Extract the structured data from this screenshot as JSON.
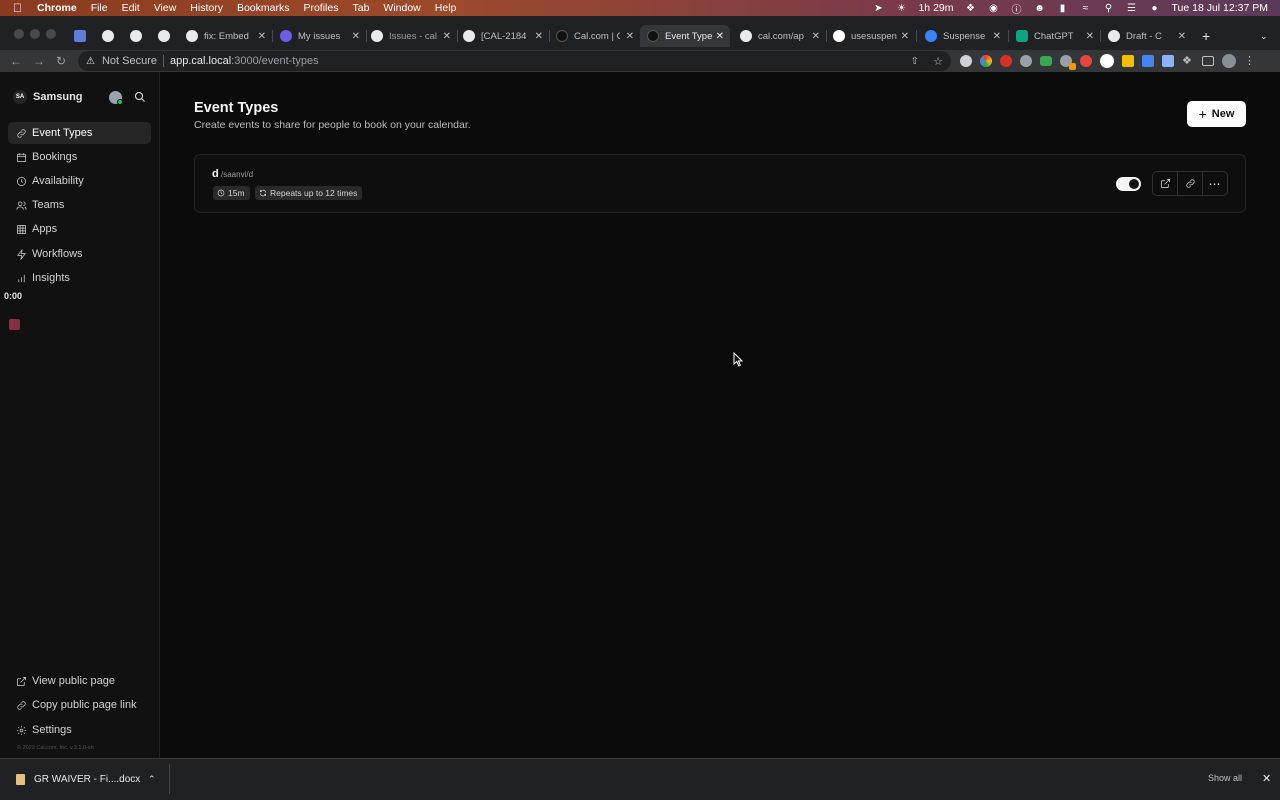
{
  "menubar": {
    "app_name": "Chrome",
    "items": [
      "File",
      "Edit",
      "View",
      "History",
      "Bookmarks",
      "Profiles",
      "Tab",
      "Window",
      "Help"
    ],
    "battery_time": "1h 29m",
    "datetime": "Tue 18 Jul  12:37 PM"
  },
  "tabs": [
    {
      "label": "",
      "fav_color": "#5b7fd6"
    },
    {
      "label": "",
      "fav_color": "#e8eaed"
    },
    {
      "label": "",
      "fav_color": "#e8eaed"
    },
    {
      "label": "",
      "fav_color": "#e8eaed"
    },
    {
      "label": "fix: Embed",
      "fav_color": "#e8eaed"
    },
    {
      "label": "My issues",
      "fav_color": "#6e5de7"
    },
    {
      "label": "Issues - cal",
      "fav_color": "#e8eaed"
    },
    {
      "label": "[CAL-2184",
      "fav_color": "#e8eaed"
    },
    {
      "label": "Cal.com | C",
      "fav_color": "#111111"
    },
    {
      "label": "Event Type",
      "fav_color": "#111111"
    },
    {
      "label": "cal.com/ap",
      "fav_color": "#e8eaed"
    },
    {
      "label": "usesuspen",
      "fav_color": "#ffffff"
    },
    {
      "label": "Suspense",
      "fav_color": "#3b82f6"
    },
    {
      "label": "ChatGPT",
      "fav_color": "#10a37f"
    },
    {
      "label": "Draft - C",
      "fav_color": "#e8eaed"
    }
  ],
  "address": {
    "security": "Not Secure",
    "host": "app.cal.local",
    "path": ":3000/event-types"
  },
  "sidebar": {
    "org_initials": "SA",
    "org_name": "Samsung",
    "items": [
      {
        "label": "Event Types",
        "icon": "link-icon"
      },
      {
        "label": "Bookings",
        "icon": "calendar-icon"
      },
      {
        "label": "Availability",
        "icon": "clock-icon"
      },
      {
        "label": "Teams",
        "icon": "users-icon"
      },
      {
        "label": "Apps",
        "icon": "grid-icon"
      },
      {
        "label": "Workflows",
        "icon": "zap-icon"
      },
      {
        "label": "Insights",
        "icon": "bar-chart-icon"
      }
    ],
    "timer": "0:00",
    "bottom": [
      {
        "label": "View public page",
        "icon": "external-link-icon"
      },
      {
        "label": "Copy public page link",
        "icon": "link-icon"
      },
      {
        "label": "Settings",
        "icon": "gear-icon"
      }
    ],
    "footer": "© 2023 Cal.com, Inc. v.3.1.0-sh"
  },
  "main": {
    "title": "Event Types",
    "subtitle": "Create events to share for people to book on your calendar.",
    "new_button": "New",
    "event": {
      "title": "d",
      "slug": "/saanvi/d",
      "duration": "15m",
      "recurring": "Repeats up to 12 times",
      "enabled": true
    }
  },
  "shelf": {
    "file_name": "GR WAIVER - Fi....docx",
    "show_all": "Show all"
  }
}
